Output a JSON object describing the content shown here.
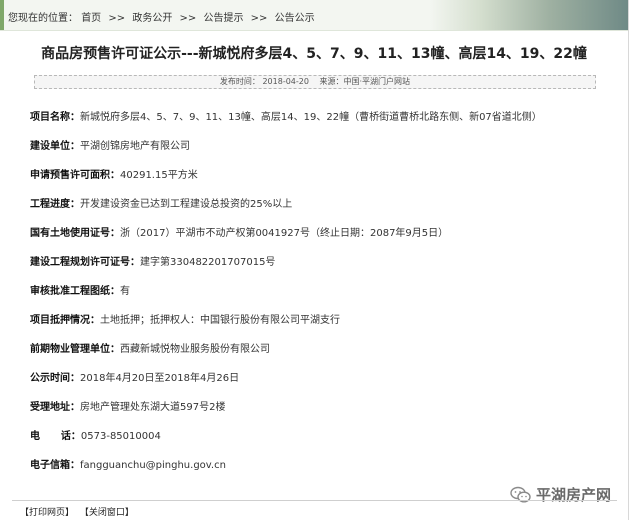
{
  "breadcrumb": {
    "prefix": "您现在的位置：",
    "items": [
      "首页",
      "政务公开",
      "公告提示",
      "公告公示"
    ],
    "separator": ">>"
  },
  "title": "商品房预售许可证公示---新城悦府多层4、5、7、9、11、13幢、高层14、19、22幢",
  "meta": {
    "publish_time": "发布时间：   2018-04-20",
    "source": "来源：中国·平湖门户网站"
  },
  "rows": [
    {
      "label": "项目名称：",
      "value": "新城悦府多层4、5、7、9、11、13幢、高层14、19、22幢（曹桥街道曹桥北路东侧、新07省道北侧）"
    },
    {
      "label": "建设单位：",
      "value": "平湖创锦房地产有限公司"
    },
    {
      "label": "申请预售许可面积：",
      "value": "40291.15平方米"
    },
    {
      "label": "工程进度：",
      "value": "开发建设资金已达到工程建设总投资的25%以上"
    },
    {
      "label": "国有土地使用证号：",
      "value": "浙（2017）平湖市不动产权第0041927号（终止日期：2087年9月5日）"
    },
    {
      "label": "建设工程规划许可证号：",
      "value": "建字第330482201707015号"
    },
    {
      "label": "审核批准工程图纸：",
      "value": "有"
    },
    {
      "label": "项目抵押情况：",
      "value": "土地抵押；抵押权人：中国银行股份有限公司平湖支行"
    },
    {
      "label": "前期物业管理单位：",
      "value": "西藏新城悦物业服务股份有限公司"
    },
    {
      "label": "公示时间：",
      "value": "2018年4月20日至2018年4月26日"
    },
    {
      "label": "受理地址：",
      "value": "房地产管理处东湖大道597号2楼"
    },
    {
      "label": "电      话：",
      "value": "0573-85010004"
    },
    {
      "label": "电子信箱：",
      "value": "fangguanchu@pinghu.gov.cn"
    }
  ],
  "footer": {
    "print_label": "【打印网页】",
    "close_label": "【关闭窗口】"
  },
  "watermark": {
    "text": "平湖房产网",
    "icon": "wechat-icon",
    "color": "#6a6a6a"
  },
  "colors": {
    "accent": "#7fa86a",
    "crumb_bg": "#f3f6f1"
  }
}
